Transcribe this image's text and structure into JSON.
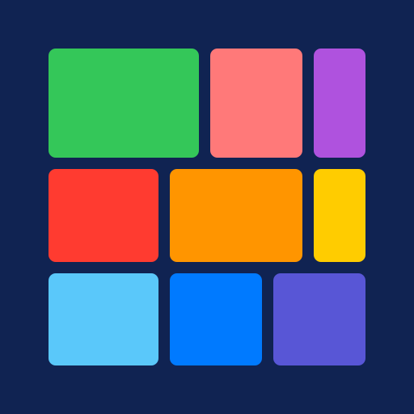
{
  "app_icon": {
    "background_color": "#102352",
    "tiles": [
      {
        "color": "#34C759"
      },
      {
        "color": "#FF7979"
      },
      {
        "color": "#AF52DE"
      },
      {
        "color": "#FF3B30"
      },
      {
        "color": "#FF9500"
      },
      {
        "color": "#FFCC00"
      },
      {
        "color": "#5AC8FA"
      },
      {
        "color": "#007AFF"
      },
      {
        "color": "#5856D6"
      }
    ]
  }
}
